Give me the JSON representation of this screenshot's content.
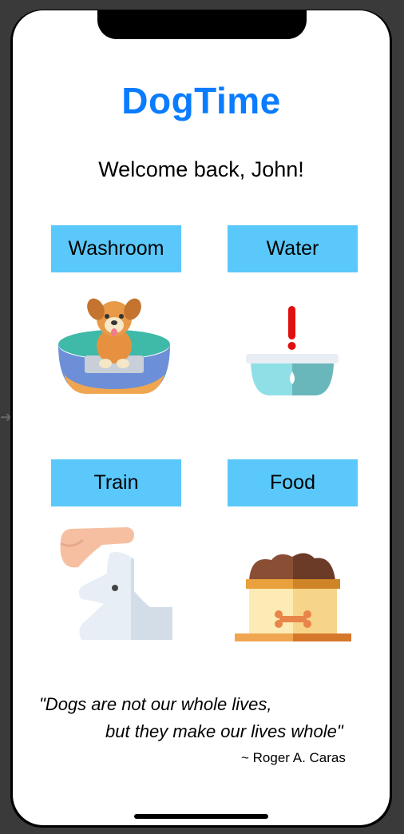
{
  "app": {
    "title": "DogTime",
    "welcome": "Welcome back, John!"
  },
  "actions": [
    {
      "label": "Washroom",
      "icon": "dog-bed-icon"
    },
    {
      "label": "Water",
      "icon": "water-bowl-icon"
    },
    {
      "label": "Train",
      "icon": "hand-petting-dog-icon"
    },
    {
      "label": "Food",
      "icon": "food-bowl-icon"
    }
  ],
  "quote": {
    "line1": "\"Dogs are not our whole lives,",
    "line2": "but they make our lives whole\"",
    "author": "~ Roger A. Caras"
  },
  "colors": {
    "accent": "#0a7cff",
    "button": "#5ac8fa"
  }
}
